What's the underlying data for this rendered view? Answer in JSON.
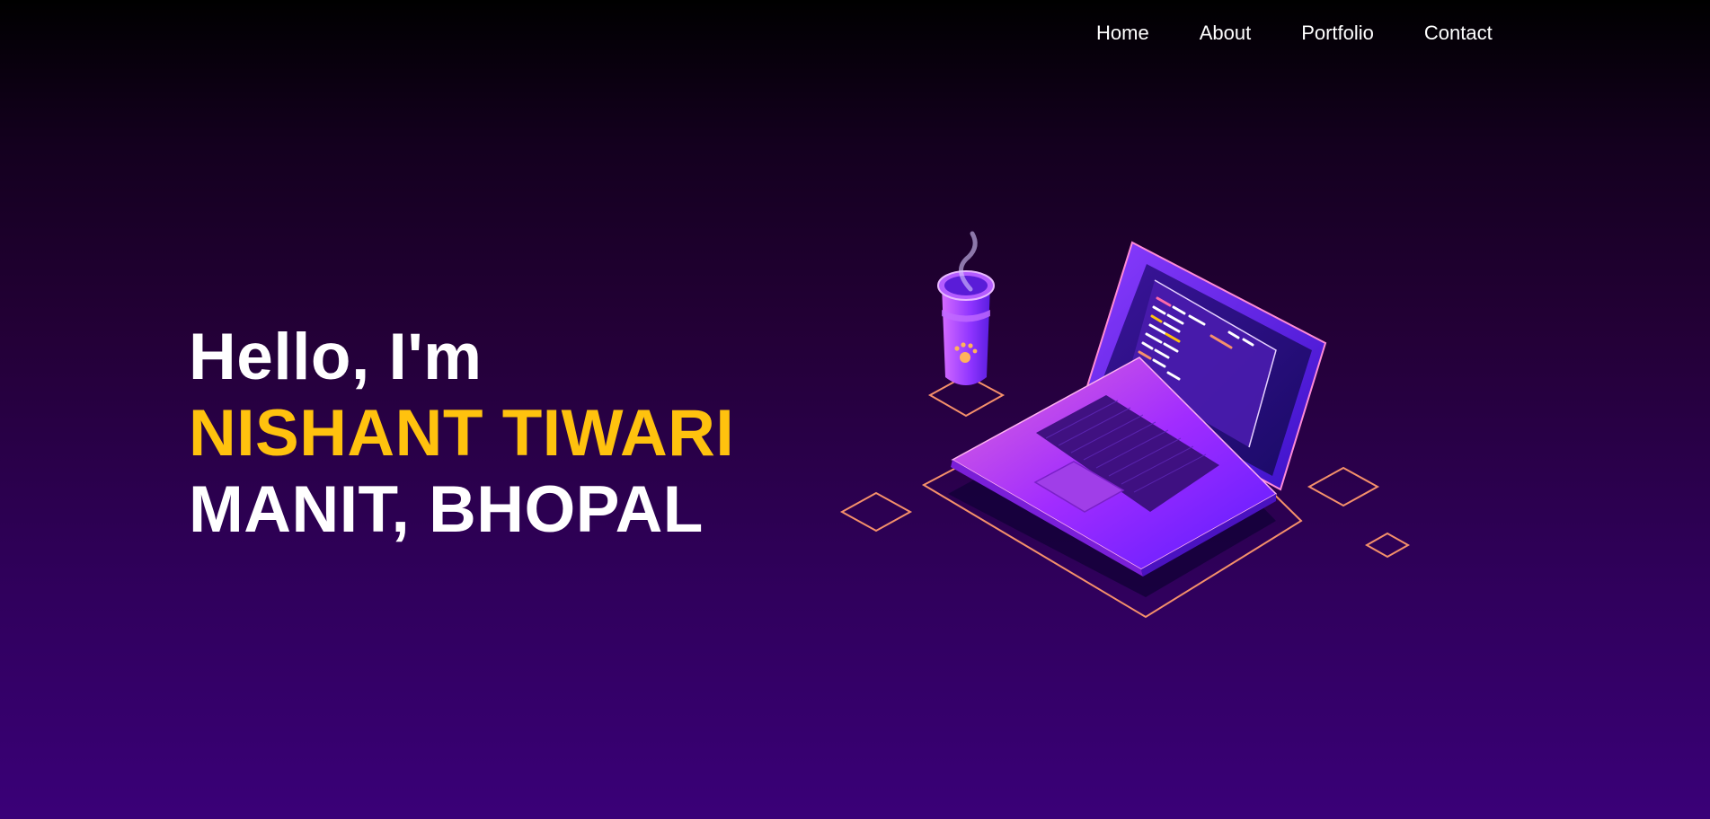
{
  "nav": {
    "items": [
      {
        "label": "Home"
      },
      {
        "label": "About"
      },
      {
        "label": "Portfolio"
      },
      {
        "label": "Contact"
      }
    ]
  },
  "hero": {
    "greeting": "Hello, I'm",
    "name": "NISHANT TIWARI",
    "location": "MANIT, BHOPAL"
  },
  "colors": {
    "background_top": "#000000",
    "background_bottom": "#3a0078",
    "name_accent": "#ffc20e",
    "text": "#ffffff",
    "outline_accent": "#f5906a",
    "laptop_purple": "#7b2cff"
  },
  "illustration": {
    "icons": [
      "laptop-icon",
      "coffee-cup-icon",
      "paw-icon"
    ]
  }
}
